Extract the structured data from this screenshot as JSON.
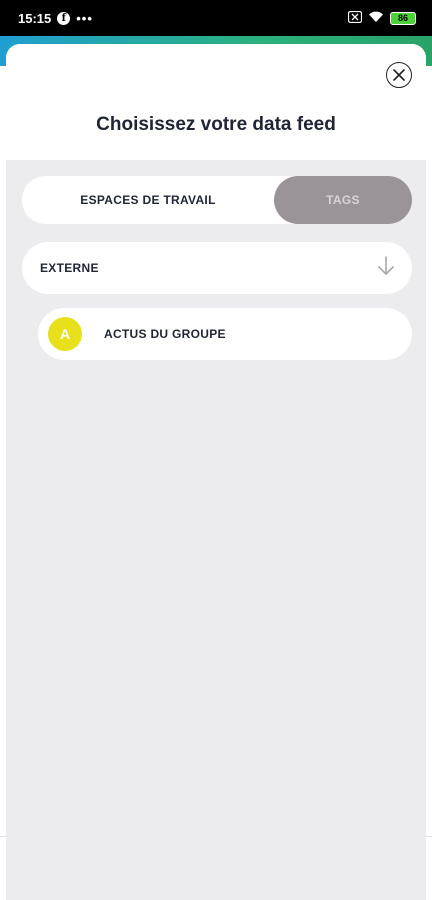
{
  "status_bar": {
    "time": "15:15",
    "info_glyph": "f",
    "dots": "•••",
    "battery_level": "86"
  },
  "sheet": {
    "title": "Choisissez votre data feed",
    "close_icon": "close-icon"
  },
  "toggle": {
    "workspaces_label": "ESPACES DE TRAVAIL",
    "tags_label": "TAGS",
    "selected": "workspaces"
  },
  "dropdown": {
    "label": "EXTERNE",
    "icon": "arrow-down-icon"
  },
  "items": [
    {
      "avatar_letter": "A",
      "label": "ACTUS DU GROUPE",
      "avatar_color": "#e8e01a"
    }
  ],
  "colors": {
    "sheet_background": "#ecebee",
    "inactive_tab": "#9a9499",
    "title_text": "#1f2436",
    "avatar_yellow": "#e8e01a"
  }
}
